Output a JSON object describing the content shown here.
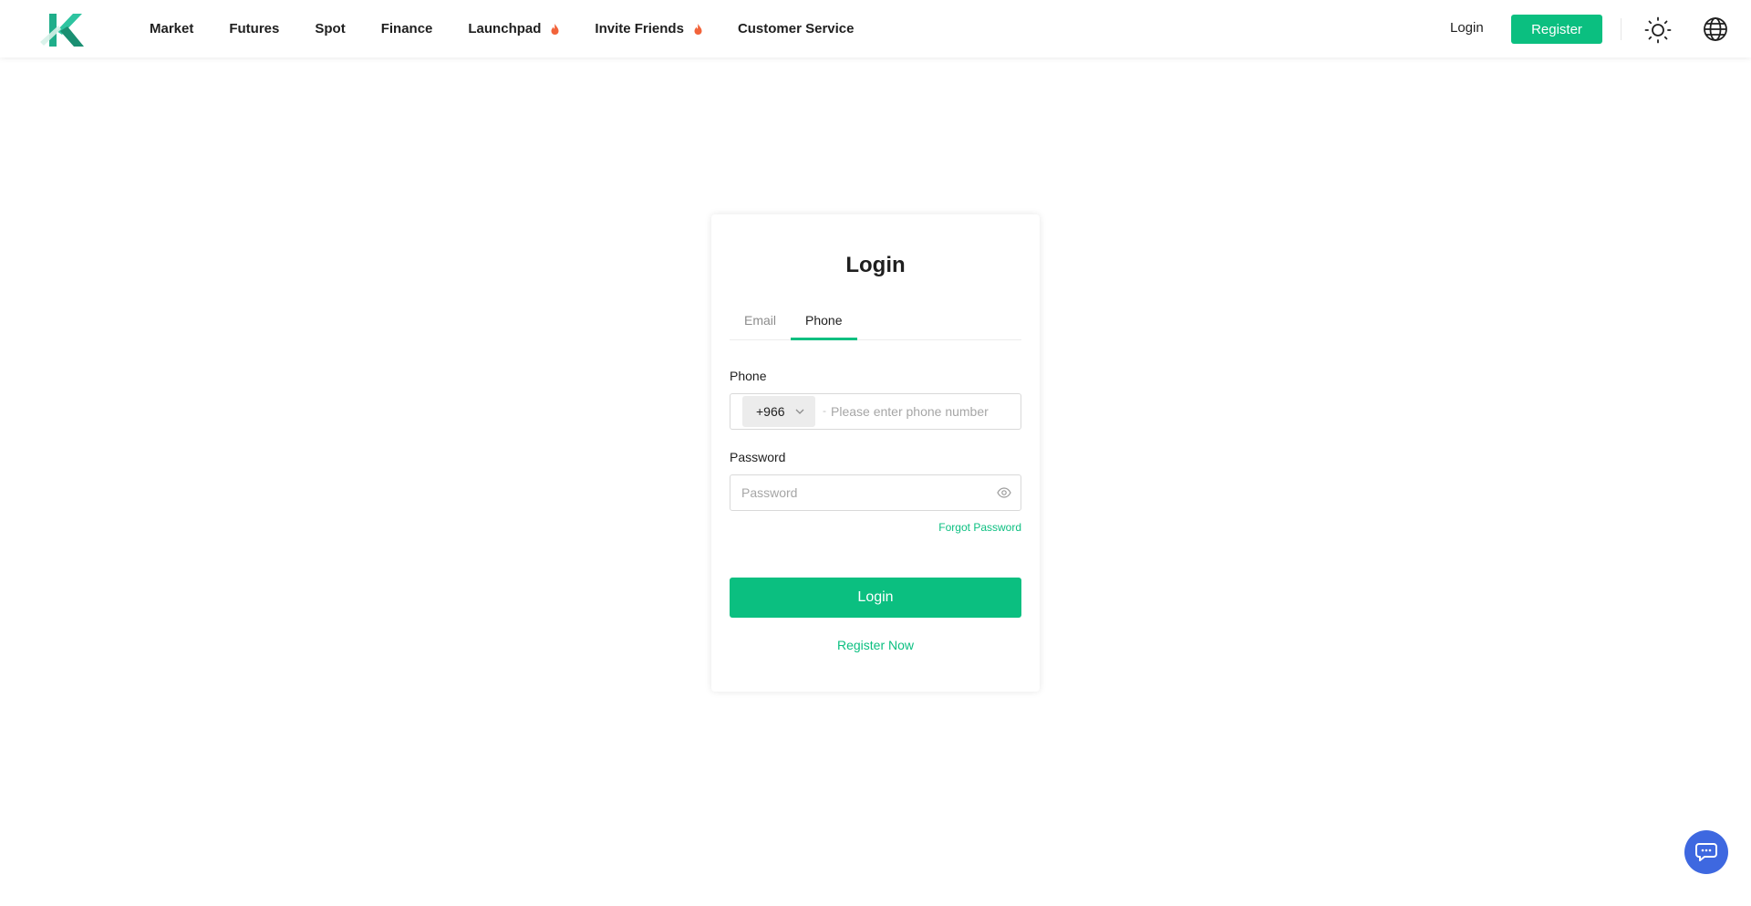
{
  "header": {
    "logo_icon": "k-logo-icon",
    "nav": [
      {
        "label": "Market"
      },
      {
        "label": "Futures"
      },
      {
        "label": "Spot"
      },
      {
        "label": "Finance"
      },
      {
        "label": "Launchpad",
        "badge_icon": "fire-icon"
      },
      {
        "label": "Invite Friends",
        "badge_icon": "fire-icon"
      },
      {
        "label": "Customer Service"
      }
    ],
    "login_label": "Login",
    "register_label": "Register",
    "theme_icon": "sun-icon",
    "language_icon": "globe-icon"
  },
  "login_card": {
    "title": "Login",
    "tabs": [
      {
        "label": "Email",
        "active": false
      },
      {
        "label": "Phone",
        "active": true
      }
    ],
    "phone_label": "Phone",
    "country_code": "+966",
    "phone_placeholder": "Please enter phone number",
    "password_label": "Password",
    "password_placeholder": "Password",
    "forgot_password": "Forgot Password",
    "login_button": "Login",
    "register_now": "Register Now"
  },
  "chat_icon": "chat-bubble-icon",
  "colors": {
    "accent": "#0bbf80",
    "chat": "#3e68e0"
  }
}
